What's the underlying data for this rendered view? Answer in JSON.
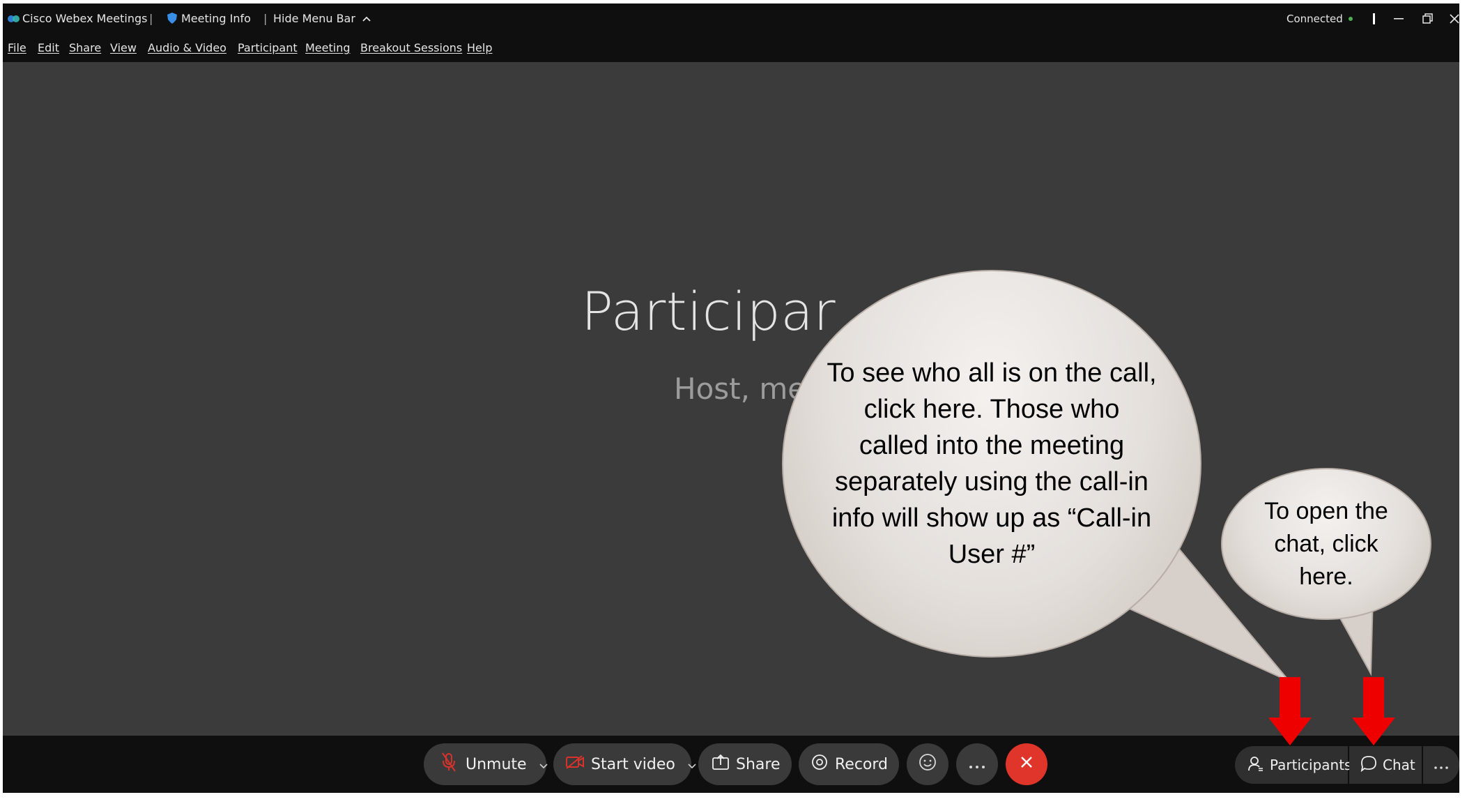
{
  "titlebar": {
    "app_title": "Cisco Webex Meetings",
    "separator": "|",
    "meeting_info": "Meeting Info",
    "hide_menu_bar": "Hide Menu Bar",
    "status": "Connected",
    "status_color": "#4caf50"
  },
  "menubar": {
    "items": [
      {
        "label": "File"
      },
      {
        "label": "Edit"
      },
      {
        "label": "Share"
      },
      {
        "label": "View"
      },
      {
        "label": "Audio & Video"
      },
      {
        "label": "Participant"
      },
      {
        "label": "Meeting"
      },
      {
        "label": "Breakout Sessions"
      },
      {
        "label": "Help"
      }
    ]
  },
  "stage": {
    "title_visible": "Participar",
    "subtitle_visible": "Host, me"
  },
  "callouts": {
    "participants_note": "To see who all is on the call, click here. Those who called into the meeting separately using the call-in info will show up as “Call-in User #”",
    "chat_note": "To open the chat, click here."
  },
  "controls": {
    "unmute_label": "Unmute",
    "start_video_label": "Start video",
    "share_label": "Share",
    "record_label": "Record",
    "participants_label": "Participants",
    "chat_label": "Chat",
    "end_color": "#e0352b",
    "mute_icon_color": "#d9322b"
  },
  "colors": {
    "arrow": "#ee0000",
    "bubble_fill": "#e6e1dd"
  }
}
